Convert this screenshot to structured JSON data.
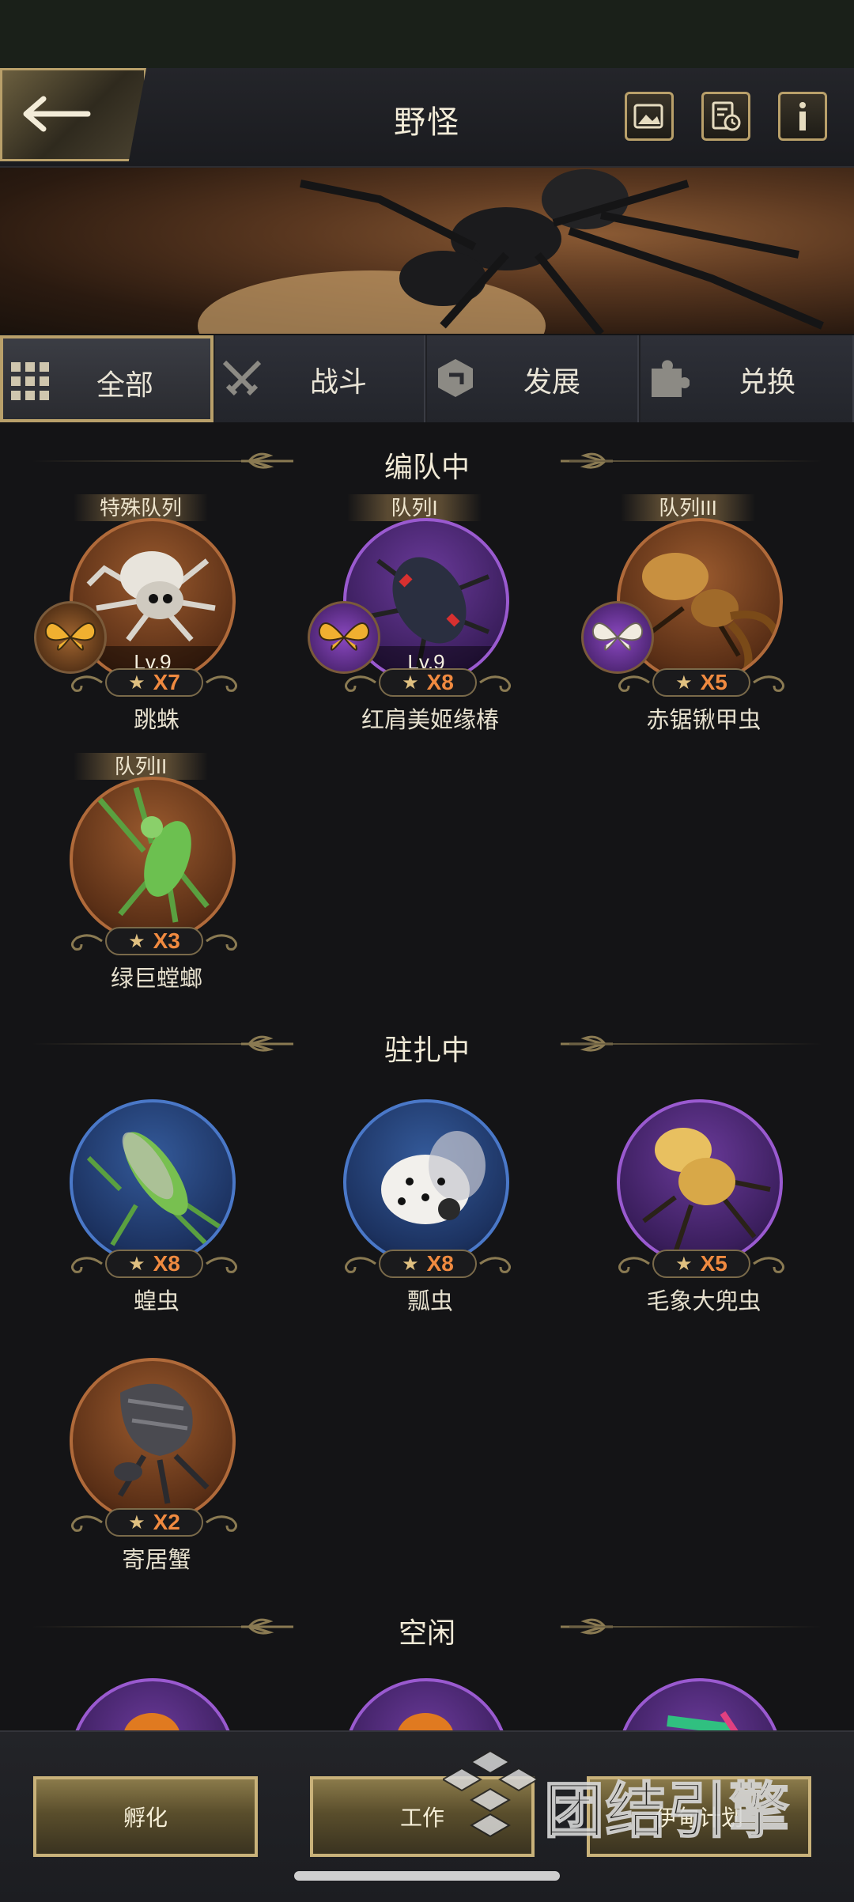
{
  "header": {
    "title": "野怪"
  },
  "tabs": [
    {
      "label": "全部"
    },
    {
      "label": "战斗"
    },
    {
      "label": "发展"
    },
    {
      "label": "兑换"
    }
  ],
  "sections": {
    "formation": {
      "label": "编队中"
    },
    "stationed": {
      "label": "驻扎中"
    },
    "idle": {
      "label": "空闲"
    }
  },
  "formation_cards": [
    {
      "tag": "特殊队列",
      "level": "Lv.9",
      "count": "X7",
      "name": "跳蛛",
      "ring": "orange",
      "butterfly": "orange"
    },
    {
      "tag": "队列I",
      "level": "Lv.9",
      "count": "X8",
      "name": "红肩美姬缘椿",
      "ring": "purple",
      "butterfly": "purple"
    },
    {
      "tag": "队列III",
      "level": "",
      "count": "X5",
      "name": "赤锯锹甲虫",
      "ring": "orange",
      "butterfly": "purple"
    },
    {
      "tag": "队列II",
      "level": "",
      "count": "X3",
      "name": "绿巨螳螂",
      "ring": "orange",
      "butterfly": ""
    }
  ],
  "stationed_cards": [
    {
      "count": "X8",
      "name": "蝗虫",
      "ring": "blue"
    },
    {
      "count": "X8",
      "name": "瓢虫",
      "ring": "blue"
    },
    {
      "count": "X5",
      "name": "毛象大兜虫",
      "ring": "purple"
    },
    {
      "count": "X2",
      "name": "寄居蟹",
      "ring": "orange"
    }
  ],
  "bottom_buttons": [
    {
      "label": "孵化"
    },
    {
      "label": "工作"
    },
    {
      "label": "伊甸计划"
    }
  ],
  "watermark": {
    "text": "团结引擎"
  },
  "colors": {
    "accent_gold": "#b9a06a",
    "count_orange": "#f08a40"
  }
}
